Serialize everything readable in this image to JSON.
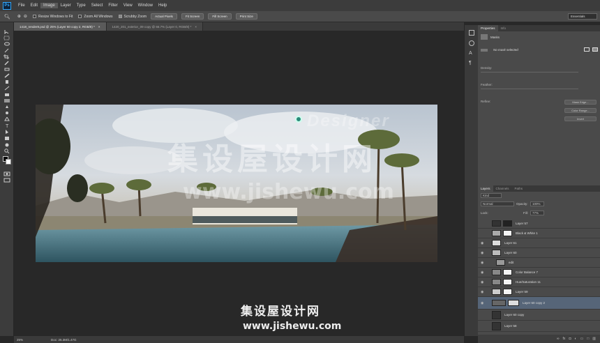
{
  "app": {
    "logo": "Ps"
  },
  "menu": [
    "File",
    "Edit",
    "Image",
    "Layer",
    "Type",
    "Select",
    "Filter",
    "View",
    "Window",
    "Help"
  ],
  "options_bar": {
    "resize_windows": "Resize Windows to Fit",
    "zoom_all": "Zoom All Windows",
    "scrubby_zoom": "Scrubby Zoom",
    "actual_pixels": "Actual Pixels",
    "fit_screen": "Fit Screen",
    "fill_screen": "Fill Screen",
    "print_size": "Print Size",
    "workspace": "Essentials"
  },
  "doc_tabs": [
    "1418_render8.psd @ 25% (Layer 60 copy 2, RGB/8) *",
    "1420_201_exterior_09 copy @ 66.7% (Layer 0, RGB/8) *"
  ],
  "status": {
    "zoom": "25%",
    "doc": "Doc: 25.3M/1.47G"
  },
  "properties": {
    "tabs": [
      "Properties",
      "Info"
    ],
    "section": "Masks",
    "no_mask": "No mask selected",
    "density": "Density:",
    "feather": "Feather:",
    "refine": "Refine:",
    "mask_edge": "Mask Edge...",
    "color_range": "Color Range...",
    "invert": "Invert"
  },
  "layers_panel": {
    "tabs": [
      "Layers",
      "Channels",
      "Paths"
    ],
    "kind": "Kind",
    "blend": "Normal",
    "opacity_label": "Opacity:",
    "opacity": "100%",
    "lock_label": "Lock:",
    "fill_label": "Fill:",
    "fill": "77%",
    "layers": [
      {
        "name": "Layer 57"
      },
      {
        "name": "Black & White 1"
      },
      {
        "name": "Layer 61"
      },
      {
        "name": "Layer 60"
      },
      {
        "name": "edit"
      },
      {
        "name": "Color Balance 7"
      },
      {
        "name": "Hue/Saturation 11"
      },
      {
        "name": "Layer 59"
      },
      {
        "name": "Layer 60 copy 2"
      },
      {
        "name": "Layer 60 copy"
      },
      {
        "name": "Layer 58"
      }
    ]
  },
  "watermark": {
    "big_cn": "集设屋设计网",
    "mid_url": "www.jishewu.com",
    "designer": "Designer",
    "bottom_cn": "集设屋设计网",
    "bottom_url": "www.jishewu.com"
  }
}
